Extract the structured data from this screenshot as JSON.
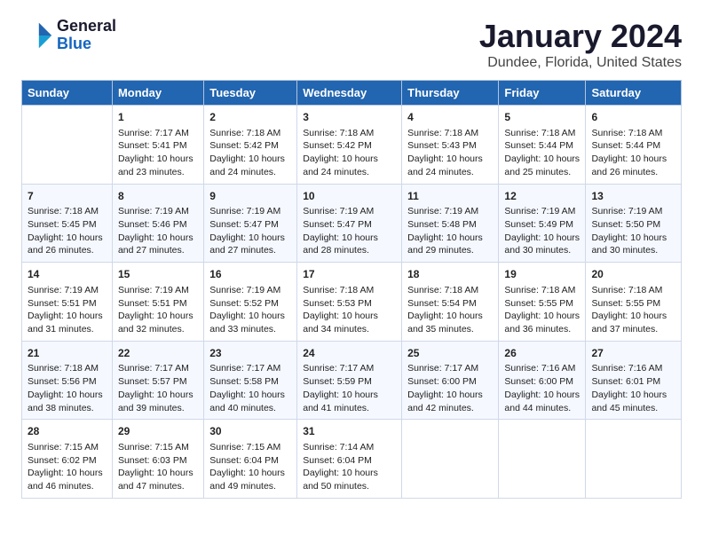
{
  "app": {
    "logo_line1": "General",
    "logo_line2": "Blue"
  },
  "header": {
    "title": "January 2024",
    "subtitle": "Dundee, Florida, United States"
  },
  "calendar": {
    "weekdays": [
      "Sunday",
      "Monday",
      "Tuesday",
      "Wednesday",
      "Thursday",
      "Friday",
      "Saturday"
    ],
    "weeks": [
      [
        {
          "day": "",
          "sunrise": "",
          "sunset": "",
          "daylight": ""
        },
        {
          "day": "1",
          "sunrise": "Sunrise: 7:17 AM",
          "sunset": "Sunset: 5:41 PM",
          "daylight": "Daylight: 10 hours and 23 minutes."
        },
        {
          "day": "2",
          "sunrise": "Sunrise: 7:18 AM",
          "sunset": "Sunset: 5:42 PM",
          "daylight": "Daylight: 10 hours and 24 minutes."
        },
        {
          "day": "3",
          "sunrise": "Sunrise: 7:18 AM",
          "sunset": "Sunset: 5:42 PM",
          "daylight": "Daylight: 10 hours and 24 minutes."
        },
        {
          "day": "4",
          "sunrise": "Sunrise: 7:18 AM",
          "sunset": "Sunset: 5:43 PM",
          "daylight": "Daylight: 10 hours and 24 minutes."
        },
        {
          "day": "5",
          "sunrise": "Sunrise: 7:18 AM",
          "sunset": "Sunset: 5:44 PM",
          "daylight": "Daylight: 10 hours and 25 minutes."
        },
        {
          "day": "6",
          "sunrise": "Sunrise: 7:18 AM",
          "sunset": "Sunset: 5:44 PM",
          "daylight": "Daylight: 10 hours and 26 minutes."
        }
      ],
      [
        {
          "day": "7",
          "sunrise": "Sunrise: 7:18 AM",
          "sunset": "Sunset: 5:45 PM",
          "daylight": "Daylight: 10 hours and 26 minutes."
        },
        {
          "day": "8",
          "sunrise": "Sunrise: 7:19 AM",
          "sunset": "Sunset: 5:46 PM",
          "daylight": "Daylight: 10 hours and 27 minutes."
        },
        {
          "day": "9",
          "sunrise": "Sunrise: 7:19 AM",
          "sunset": "Sunset: 5:47 PM",
          "daylight": "Daylight: 10 hours and 27 minutes."
        },
        {
          "day": "10",
          "sunrise": "Sunrise: 7:19 AM",
          "sunset": "Sunset: 5:47 PM",
          "daylight": "Daylight: 10 hours and 28 minutes."
        },
        {
          "day": "11",
          "sunrise": "Sunrise: 7:19 AM",
          "sunset": "Sunset: 5:48 PM",
          "daylight": "Daylight: 10 hours and 29 minutes."
        },
        {
          "day": "12",
          "sunrise": "Sunrise: 7:19 AM",
          "sunset": "Sunset: 5:49 PM",
          "daylight": "Daylight: 10 hours and 30 minutes."
        },
        {
          "day": "13",
          "sunrise": "Sunrise: 7:19 AM",
          "sunset": "Sunset: 5:50 PM",
          "daylight": "Daylight: 10 hours and 30 minutes."
        }
      ],
      [
        {
          "day": "14",
          "sunrise": "Sunrise: 7:19 AM",
          "sunset": "Sunset: 5:51 PM",
          "daylight": "Daylight: 10 hours and 31 minutes."
        },
        {
          "day": "15",
          "sunrise": "Sunrise: 7:19 AM",
          "sunset": "Sunset: 5:51 PM",
          "daylight": "Daylight: 10 hours and 32 minutes."
        },
        {
          "day": "16",
          "sunrise": "Sunrise: 7:19 AM",
          "sunset": "Sunset: 5:52 PM",
          "daylight": "Daylight: 10 hours and 33 minutes."
        },
        {
          "day": "17",
          "sunrise": "Sunrise: 7:18 AM",
          "sunset": "Sunset: 5:53 PM",
          "daylight": "Daylight: 10 hours and 34 minutes."
        },
        {
          "day": "18",
          "sunrise": "Sunrise: 7:18 AM",
          "sunset": "Sunset: 5:54 PM",
          "daylight": "Daylight: 10 hours and 35 minutes."
        },
        {
          "day": "19",
          "sunrise": "Sunrise: 7:18 AM",
          "sunset": "Sunset: 5:55 PM",
          "daylight": "Daylight: 10 hours and 36 minutes."
        },
        {
          "day": "20",
          "sunrise": "Sunrise: 7:18 AM",
          "sunset": "Sunset: 5:55 PM",
          "daylight": "Daylight: 10 hours and 37 minutes."
        }
      ],
      [
        {
          "day": "21",
          "sunrise": "Sunrise: 7:18 AM",
          "sunset": "Sunset: 5:56 PM",
          "daylight": "Daylight: 10 hours and 38 minutes."
        },
        {
          "day": "22",
          "sunrise": "Sunrise: 7:17 AM",
          "sunset": "Sunset: 5:57 PM",
          "daylight": "Daylight: 10 hours and 39 minutes."
        },
        {
          "day": "23",
          "sunrise": "Sunrise: 7:17 AM",
          "sunset": "Sunset: 5:58 PM",
          "daylight": "Daylight: 10 hours and 40 minutes."
        },
        {
          "day": "24",
          "sunrise": "Sunrise: 7:17 AM",
          "sunset": "Sunset: 5:59 PM",
          "daylight": "Daylight: 10 hours and 41 minutes."
        },
        {
          "day": "25",
          "sunrise": "Sunrise: 7:17 AM",
          "sunset": "Sunset: 6:00 PM",
          "daylight": "Daylight: 10 hours and 42 minutes."
        },
        {
          "day": "26",
          "sunrise": "Sunrise: 7:16 AM",
          "sunset": "Sunset: 6:00 PM",
          "daylight": "Daylight: 10 hours and 44 minutes."
        },
        {
          "day": "27",
          "sunrise": "Sunrise: 7:16 AM",
          "sunset": "Sunset: 6:01 PM",
          "daylight": "Daylight: 10 hours and 45 minutes."
        }
      ],
      [
        {
          "day": "28",
          "sunrise": "Sunrise: 7:15 AM",
          "sunset": "Sunset: 6:02 PM",
          "daylight": "Daylight: 10 hours and 46 minutes."
        },
        {
          "day": "29",
          "sunrise": "Sunrise: 7:15 AM",
          "sunset": "Sunset: 6:03 PM",
          "daylight": "Daylight: 10 hours and 47 minutes."
        },
        {
          "day": "30",
          "sunrise": "Sunrise: 7:15 AM",
          "sunset": "Sunset: 6:04 PM",
          "daylight": "Daylight: 10 hours and 49 minutes."
        },
        {
          "day": "31",
          "sunrise": "Sunrise: 7:14 AM",
          "sunset": "Sunset: 6:04 PM",
          "daylight": "Daylight: 10 hours and 50 minutes."
        },
        {
          "day": "",
          "sunrise": "",
          "sunset": "",
          "daylight": ""
        },
        {
          "day": "",
          "sunrise": "",
          "sunset": "",
          "daylight": ""
        },
        {
          "day": "",
          "sunrise": "",
          "sunset": "",
          "daylight": ""
        }
      ]
    ]
  }
}
